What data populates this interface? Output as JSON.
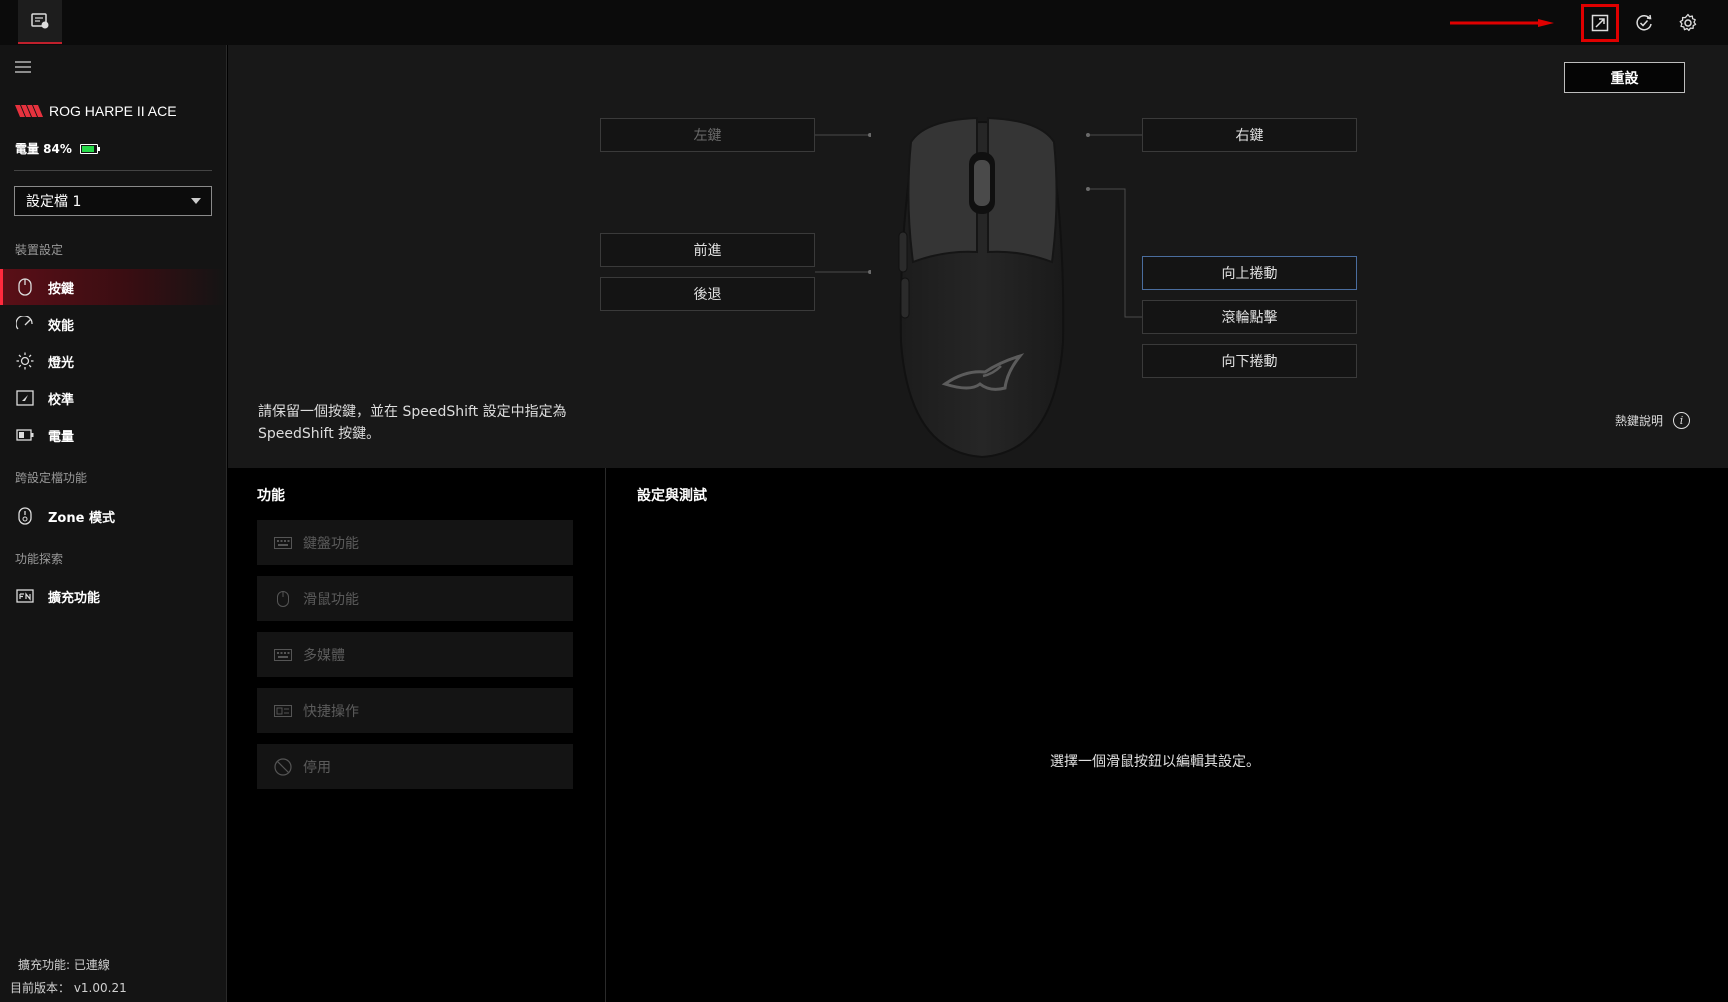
{
  "colors": {
    "accent": "#ff2a3d",
    "battery": "#27d84a",
    "highlight_box": "#e00000",
    "selected_border": "#4a6d9e"
  },
  "topbar": {
    "icons": [
      "device-icon",
      "update-icon",
      "sync-icon",
      "gear-icon"
    ]
  },
  "sidebar": {
    "device_name": "ROG HARPE II ACE",
    "battery": {
      "label": "電量 84%",
      "level": 0.84
    },
    "profile": "設定檔 1",
    "sections": {
      "device_settings": "裝置設定",
      "cross_profile": "跨設定檔功能",
      "explore": "功能探索"
    },
    "items": [
      {
        "label": "按鍵",
        "icon": "mouse-icon"
      },
      {
        "label": "效能",
        "icon": "performance-icon"
      },
      {
        "label": "燈光",
        "icon": "light-icon"
      },
      {
        "label": "校準",
        "icon": "calibration-icon"
      },
      {
        "label": "電量",
        "icon": "battery-icon"
      },
      {
        "label": "Zone 模式",
        "icon": "zone-mode-icon"
      },
      {
        "label": "擴充功能",
        "icon": "fn-icon"
      }
    ],
    "footer": {
      "extension_status": "擴充功能: 已連線",
      "version": "目前版本： v1.00.21"
    }
  },
  "main": {
    "reset_label": "重設",
    "buttons": {
      "left": "左鍵",
      "right": "右鍵",
      "forward": "前進",
      "back": "後退",
      "scroll_up": "向上捲動",
      "wheel_click": "滾輪點擊",
      "scroll_down": "向下捲動"
    },
    "info_text": "請保留一個按鍵，並在 SpeedShift 設定中指定為 SpeedShift 按鍵。",
    "hotkey_label": "熱鍵說明",
    "info_glyph": "i"
  },
  "functions": {
    "title": "功能",
    "items": [
      {
        "label": "鍵盤功能",
        "icon": "keyboard-icon"
      },
      {
        "label": "滑鼠功能",
        "icon": "mouse-icon"
      },
      {
        "label": "多媒體",
        "icon": "multimedia-icon"
      },
      {
        "label": "快捷操作",
        "icon": "shortcut-icon"
      },
      {
        "label": "停用",
        "icon": "disable-icon"
      }
    ]
  },
  "test_panel": {
    "title": "設定與測試",
    "empty_message": "選擇一個滑鼠按鈕以編輯其設定。"
  }
}
